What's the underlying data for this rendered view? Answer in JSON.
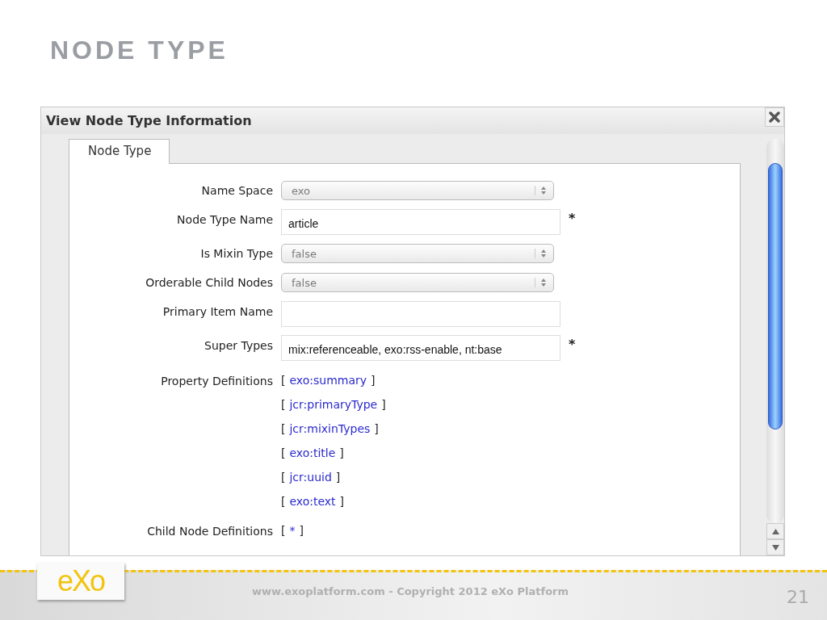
{
  "slide": {
    "title": "NODE TYPE"
  },
  "window": {
    "title": "View Node Type Information"
  },
  "tabs": [
    {
      "label": "Node Type",
      "selected": true
    }
  ],
  "fields": [
    {
      "kind": "select",
      "label": "Name Space",
      "value": "exo"
    },
    {
      "kind": "input",
      "label": "Node Type Name",
      "value": "article",
      "required_mark": "*"
    },
    {
      "kind": "select",
      "label": "Is Mixin Type",
      "value": "false"
    },
    {
      "kind": "select",
      "label": "Orderable Child Nodes",
      "value": "false"
    },
    {
      "kind": "input",
      "label": "Primary Item Name"
    },
    {
      "kind": "input",
      "label": "Super Types",
      "value": "mix:referenceable, exo:rss-enable, nt:base",
      "required_mark": "*"
    },
    {
      "kind": "links",
      "label": "Property Definitions",
      "brackets": [
        "[",
        "]"
      ],
      "links": [
        "exo:summary",
        "jcr:primaryType",
        "jcr:mixinTypes",
        "exo:title",
        "jcr:uuid",
        "exo:text"
      ]
    },
    {
      "kind": "links",
      "label": "Child Node Definitions",
      "brackets": [
        "[",
        "]"
      ],
      "links": [
        "*"
      ]
    }
  ],
  "footer": {
    "logo": "eXo",
    "copyright": "www.exoplatform.com - Copyright 2012 eXo Platform",
    "page_number": "21"
  }
}
